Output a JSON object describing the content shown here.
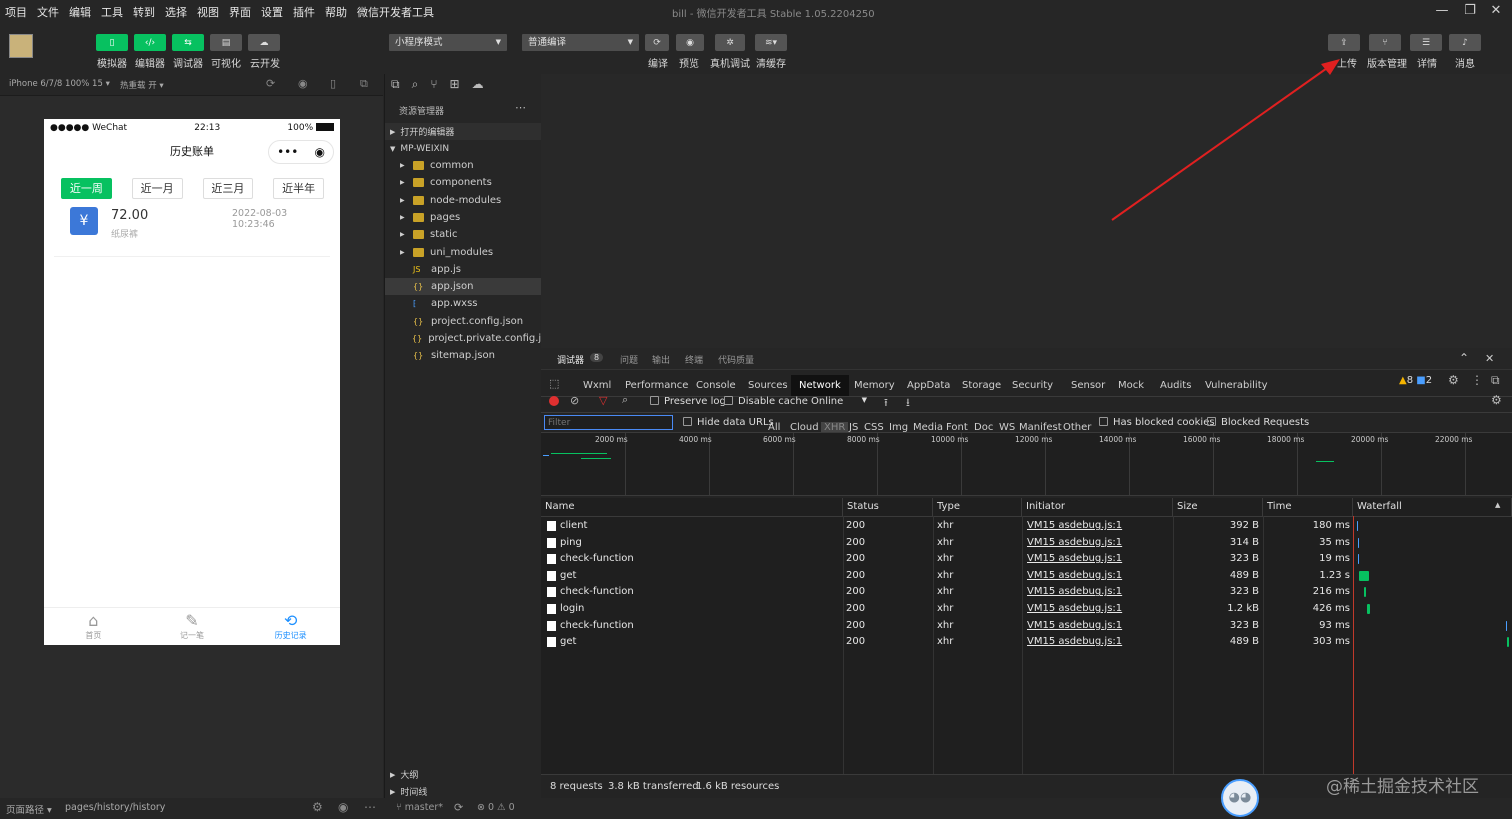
{
  "menu": [
    "项目",
    "文件",
    "编辑",
    "工具",
    "转到",
    "选择",
    "视图",
    "界面",
    "设置",
    "插件",
    "帮助",
    "微信开发者工具"
  ],
  "window": {
    "title": "bill - 微信开发者工具 Stable 1.05.2204250"
  },
  "toolbar": {
    "mode_buttons": [
      {
        "label": "模拟器",
        "icon": "phone-icon"
      },
      {
        "label": "编辑器",
        "icon": "code-icon"
      },
      {
        "label": "调试器",
        "icon": "debug-icon"
      },
      {
        "label": "可视化",
        "icon": "layout-icon"
      },
      {
        "label": "云开发",
        "icon": "cloud-icon"
      }
    ],
    "mode_select": "小程序模式",
    "compile_select": "普通编译",
    "actions": [
      {
        "label": "编译"
      },
      {
        "label": "预览"
      },
      {
        "label": "真机调试"
      },
      {
        "label": "清缓存"
      }
    ],
    "right_actions": [
      {
        "label": "上传"
      },
      {
        "label": "版本管理"
      },
      {
        "label": "详情"
      },
      {
        "label": "消息"
      }
    ]
  },
  "simulator": {
    "device": "iPhone 6/7/8 100% 15 ▾",
    "hot_reload": "热重载 开 ▾",
    "status": {
      "carrier": "●●●●● WeChat",
      "time": "22:13",
      "battery": "100%"
    },
    "page_title": "历史账单",
    "periods": [
      "近一周",
      "近一月",
      "近三月",
      "近半年"
    ],
    "record": {
      "amount": "72.00",
      "date": "2022-08-03 10:23:46",
      "note": "纸尿裤"
    },
    "tabs": [
      {
        "label": "首页",
        "icon": "home-icon"
      },
      {
        "label": "记一笔",
        "icon": "pen-icon"
      },
      {
        "label": "历史记录",
        "icon": "history-icon"
      }
    ],
    "footer": {
      "path_label": "页面路径 ▾",
      "path": "pages/history/history"
    }
  },
  "explorer": {
    "title": "资源管理器",
    "open_editors": "打开的编辑器",
    "project": "MP-WEIXIN",
    "items": [
      {
        "name": "common",
        "type": "folder"
      },
      {
        "name": "components",
        "type": "folder"
      },
      {
        "name": "node-modules",
        "type": "folder"
      },
      {
        "name": "pages",
        "type": "folder"
      },
      {
        "name": "static",
        "type": "folder"
      },
      {
        "name": "uni_modules",
        "type": "folder"
      },
      {
        "name": "app.js",
        "type": "js"
      },
      {
        "name": "app.json",
        "type": "json"
      },
      {
        "name": "app.wxss",
        "type": "css"
      },
      {
        "name": "project.config.json",
        "type": "json"
      },
      {
        "name": "project.private.config.js...",
        "type": "json"
      },
      {
        "name": "sitemap.json",
        "type": "json"
      }
    ],
    "outline": "大纲",
    "timeline": "时间线",
    "branch": "master*",
    "problems": "⊗ 0 ⚠ 0"
  },
  "devtools": {
    "top_tabs": [
      "调试器",
      "问题",
      "输出",
      "终端",
      "代码质量"
    ],
    "badge": "8",
    "panels": [
      "Wxml",
      "Performance",
      "Console",
      "Sources",
      "Network",
      "Memory",
      "AppData",
      "Storage",
      "Security",
      "Sensor",
      "Mock",
      "Audits",
      "Vulnerability"
    ],
    "warn_count": "8",
    "info_count": "2",
    "preserve_log": "Preserve log",
    "disable_cache": "Disable cache",
    "throttle": "Online",
    "filter_placeholder": "Filter",
    "hide_data_urls": "Hide data URLs",
    "types": [
      "All",
      "Cloud",
      "XHR",
      "JS",
      "CSS",
      "Img",
      "Media",
      "Font",
      "Doc",
      "WS",
      "Manifest",
      "Other"
    ],
    "has_blocked": "Has blocked cookies",
    "blocked_requests": "Blocked Requests",
    "ticks": [
      "2000 ms",
      "4000 ms",
      "6000 ms",
      "8000 ms",
      "10000 ms",
      "12000 ms",
      "14000 ms",
      "16000 ms",
      "18000 ms",
      "20000 ms",
      "22000 ms"
    ],
    "columns": [
      "Name",
      "Status",
      "Type",
      "Initiator",
      "Size",
      "Time",
      "Waterfall"
    ],
    "requests": [
      {
        "name": "client",
        "status": "200",
        "type": "xhr",
        "initiator": "VM15 asdebug.js:1",
        "size": "392 B",
        "time": "180 ms"
      },
      {
        "name": "ping",
        "status": "200",
        "type": "xhr",
        "initiator": "VM15 asdebug.js:1",
        "size": "314 B",
        "time": "35 ms"
      },
      {
        "name": "check-function",
        "status": "200",
        "type": "xhr",
        "initiator": "VM15 asdebug.js:1",
        "size": "323 B",
        "time": "19 ms"
      },
      {
        "name": "get",
        "status": "200",
        "type": "xhr",
        "initiator": "VM15 asdebug.js:1",
        "size": "489 B",
        "time": "1.23 s"
      },
      {
        "name": "check-function",
        "status": "200",
        "type": "xhr",
        "initiator": "VM15 asdebug.js:1",
        "size": "323 B",
        "time": "216 ms"
      },
      {
        "name": "login",
        "status": "200",
        "type": "xhr",
        "initiator": "VM15 asdebug.js:1",
        "size": "1.2 kB",
        "time": "426 ms"
      },
      {
        "name": "check-function",
        "status": "200",
        "type": "xhr",
        "initiator": "VM15 asdebug.js:1",
        "size": "323 B",
        "time": "93 ms"
      },
      {
        "name": "get",
        "status": "200",
        "type": "xhr",
        "initiator": "VM15 asdebug.js:1",
        "size": "489 B",
        "time": "303 ms"
      }
    ],
    "summary": {
      "requests": "8 requests",
      "transferred": "3.8 kB transferred",
      "resources": "1.6 kB resources"
    }
  },
  "watermark": "@稀土掘金技术社区",
  "colors": {
    "accent": "#07c160",
    "arrow": "#e02020",
    "link": "#4a9eff"
  }
}
